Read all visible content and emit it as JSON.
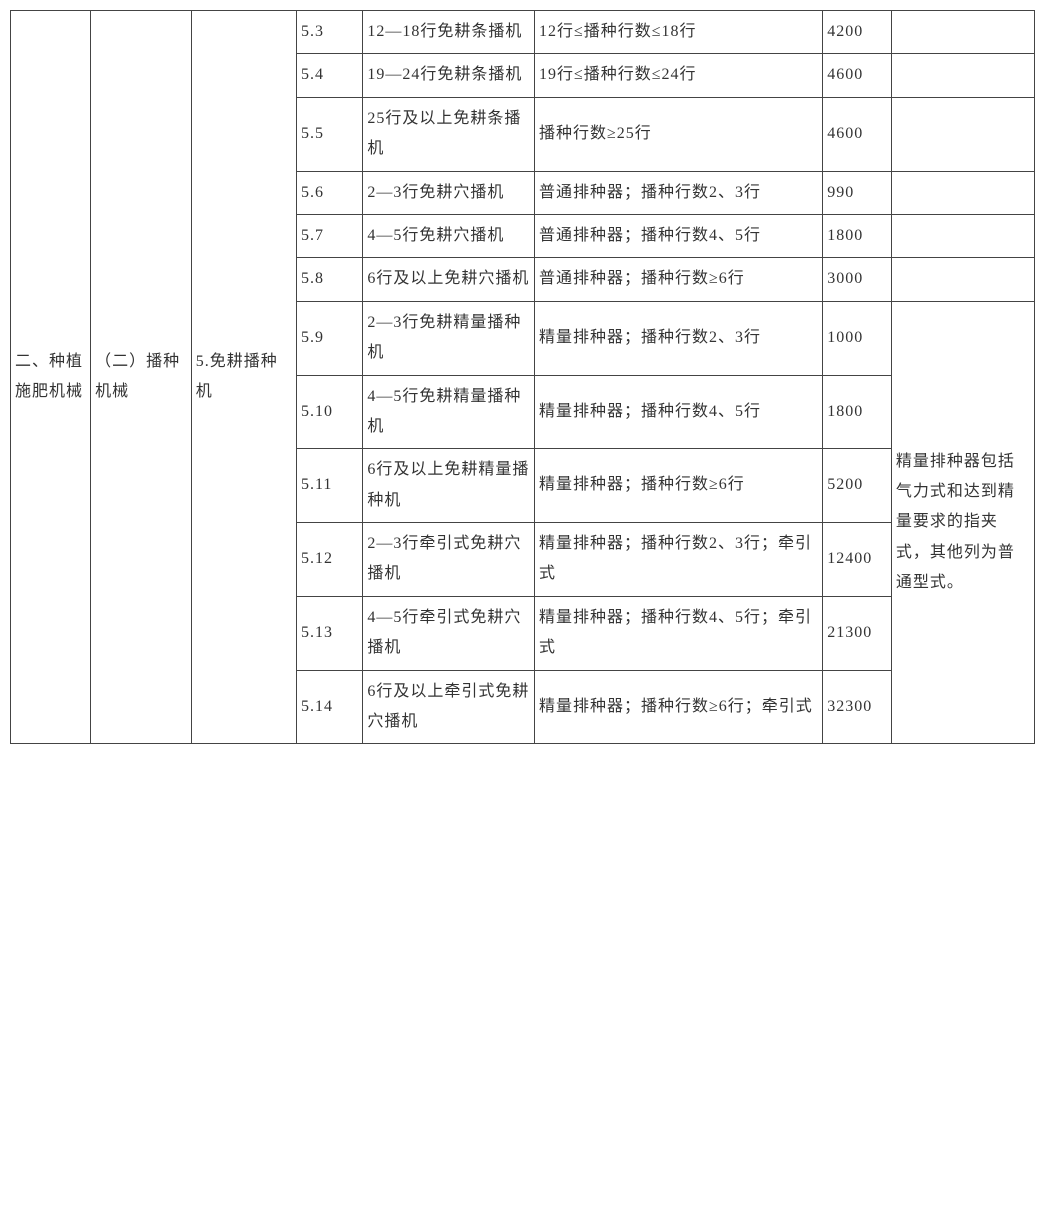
{
  "cat1": "二、种植施肥机械",
  "cat2": "（二）播种机械",
  "cat3": "5.免耕播种机",
  "rows": [
    {
      "code": "5.3",
      "name": "12—18行免耕条播机",
      "spec": "12行≤播种行数≤18行",
      "price": "4200",
      "note": ""
    },
    {
      "code": "5.4",
      "name": "19—24行免耕条播机",
      "spec": "19行≤播种行数≤24行",
      "price": "4600",
      "note": ""
    },
    {
      "code": "5.5",
      "name": "25行及以上免耕条播机",
      "spec": "播种行数≥25行",
      "price": "4600",
      "note": ""
    },
    {
      "code": "5.6",
      "name": "2—3行免耕穴播机",
      "spec": "普通排种器；播种行数2、3行",
      "price": "990",
      "note": ""
    },
    {
      "code": "5.7",
      "name": "4—5行免耕穴播机",
      "spec": "普通排种器；播种行数4、5行",
      "price": "1800",
      "note": ""
    },
    {
      "code": "5.8",
      "name": "6行及以上免耕穴播机",
      "spec": "普通排种器；播种行数≥6行",
      "price": "3000",
      "note": ""
    },
    {
      "code": "5.9",
      "name": "2—3行免耕精量播种机",
      "spec": "精量排种器；播种行数2、3行",
      "price": "1000"
    },
    {
      "code": "5.10",
      "name": "4—5行免耕精量播种机",
      "spec": "精量排种器；播种行数4、5行",
      "price": "1800"
    },
    {
      "code": "5.11",
      "name": "6行及以上免耕精量播种机",
      "spec": "精量排种器；播种行数≥6行",
      "price": "5200"
    },
    {
      "code": "5.12",
      "name": "2—3行牵引式免耕穴播机",
      "spec": "精量排种器；播种行数2、3行；牵引式",
      "price": "12400"
    },
    {
      "code": "5.13",
      "name": "4—5行牵引式免耕穴播机",
      "spec": "精量排种器；播种行数4、5行；牵引式",
      "price": "21300"
    },
    {
      "code": "5.14",
      "name": "6行及以上牵引式免耕穴播机",
      "spec": "精量排种器；播种行数≥6行；牵引式",
      "price": "32300"
    }
  ],
  "mergedNote": "精量排种器包括气力式和达到精量要求的指夹式，其他列为普通型式。"
}
